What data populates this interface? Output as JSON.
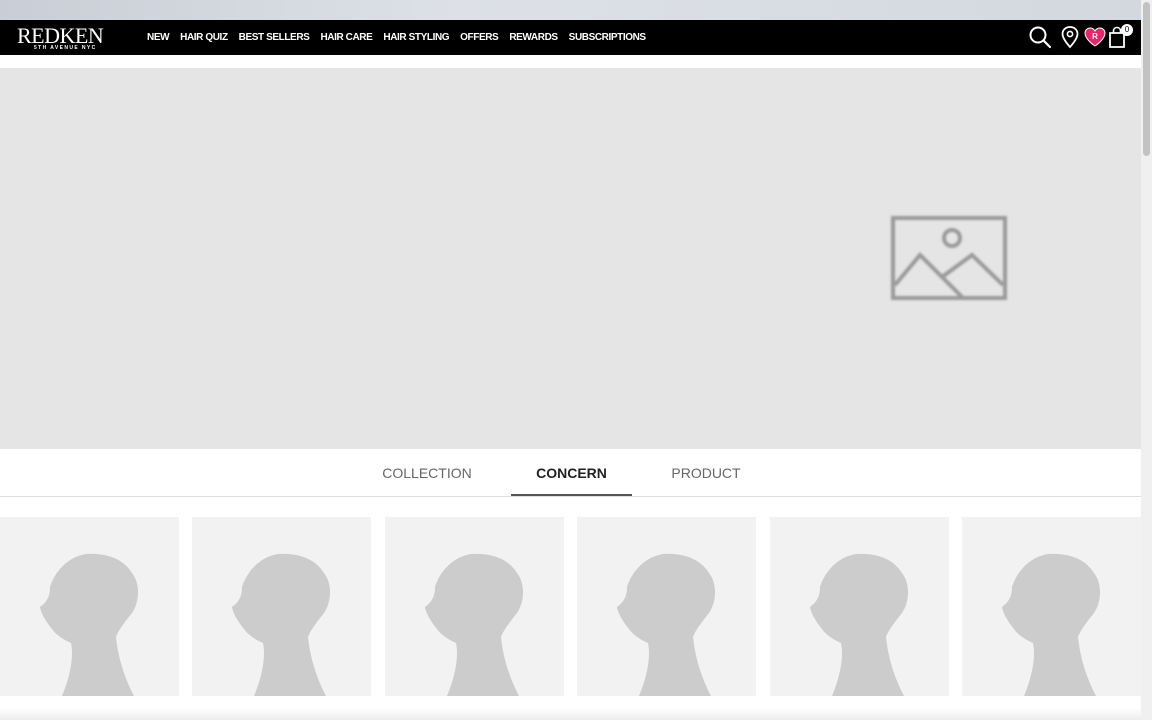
{
  "header": {
    "logo": {
      "name": "REDKEN",
      "tagline": "5TH AVENUE NYC"
    },
    "nav_items": [
      "NEW",
      "HAIR QUIZ",
      "BEST SELLERS",
      "HAIR CARE",
      "HAIR STYLING",
      "OFFERS",
      "REWARDS",
      "SUBSCRIPTIONS"
    ],
    "icons": [
      "search-icon",
      "store-locator-icon",
      "rewards-heart-icon",
      "bag-icon"
    ],
    "cart_count": "0"
  },
  "hero": {
    "image": "image-placeholder-icon"
  },
  "tabs": {
    "items": [
      "COLLECTION",
      "CONCERN",
      "PRODUCT"
    ],
    "active": "CONCERN"
  },
  "cards": {
    "count": 6,
    "image": "silhouette-placeholder"
  },
  "colors": {
    "nav_bg": "#000000",
    "heart_accent": "#e8266b",
    "hero_bg": "#e5e5e5",
    "card_bg": "#f2f2f2",
    "silhouette": "#cccccc"
  }
}
